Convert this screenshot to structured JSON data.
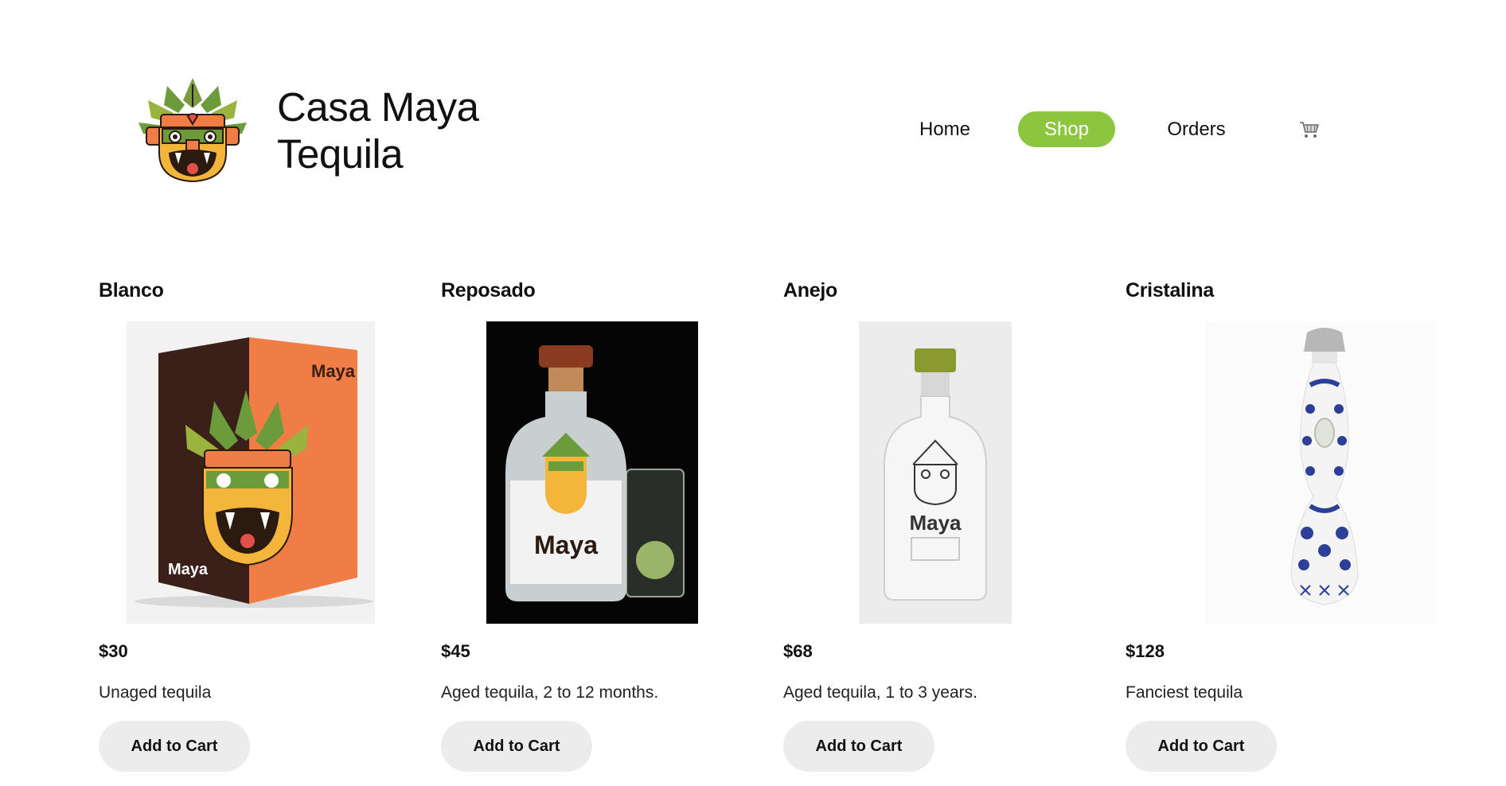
{
  "brand": {
    "name_line1": "Casa Maya",
    "name_line2": "Tequila",
    "logo_icon": "aztec-mask-logo"
  },
  "nav": {
    "home": "Home",
    "shop": "Shop",
    "orders": "Orders",
    "cart_icon": "cart-icon",
    "active": "Shop",
    "accent_color": "#8cc63f"
  },
  "products": [
    {
      "name": "Blanco",
      "price": "$30",
      "description": "Unaged tequila",
      "button": "Add to Cart",
      "image": "orange-box-packaging"
    },
    {
      "name": "Reposado",
      "price": "$45",
      "description": "Aged tequila, 2 to 12 months.",
      "button": "Add to Cart",
      "image": "clear-bottle-with-glass"
    },
    {
      "name": "Anejo",
      "price": "$68",
      "description": "Aged tequila, 1 to 3 years.",
      "button": "Add to Cart",
      "image": "white-bottle-green-cap"
    },
    {
      "name": "Cristalina",
      "price": "$128",
      "description": "Fanciest tequila",
      "button": "Add to Cart",
      "image": "blue-white-ceramic-bottle"
    }
  ],
  "colors": {
    "box_orange": "#ef7d45",
    "box_brown": "#3a2018",
    "leaf_green": "#6b9b3a",
    "mask_yellow": "#f3b63b",
    "mask_red": "#e2504a",
    "talavera_blue": "#2c3f99"
  }
}
